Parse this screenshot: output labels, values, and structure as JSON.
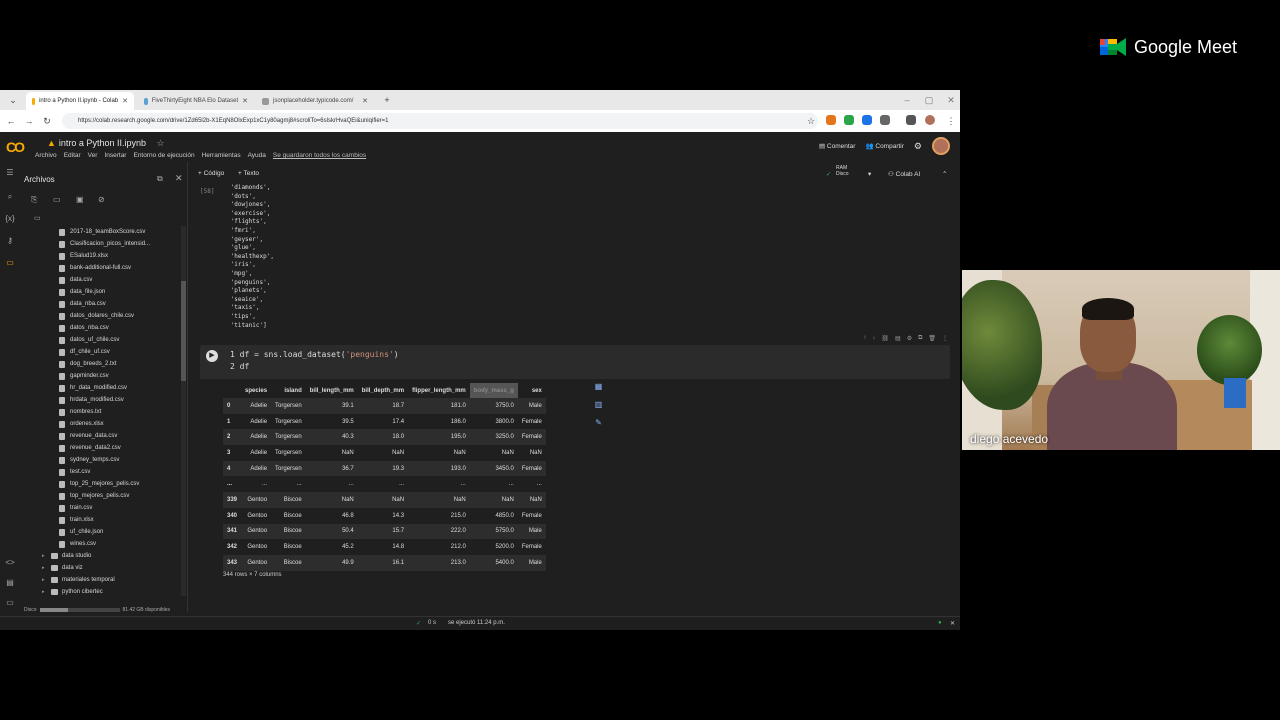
{
  "meet": {
    "brand": "Google Meet",
    "participant": "diego acevedo"
  },
  "browser": {
    "tabs": [
      {
        "title": "intro a Python II.ipynb - Colab",
        "active": true
      },
      {
        "title": "FiveThirtyEight NBA Elo Dataset",
        "active": false
      },
      {
        "title": "jsonplaceholder.typicode.com/",
        "active": false
      }
    ],
    "url": "https://colab.research.google.com/drive/1Zd65l2b-X1EqN8OlxExp1xC1y80agmj8#scrollTo=6slskrHvaQEi&uniqifier=1"
  },
  "colab": {
    "logo": "CO",
    "notebook_title": "intro a Python II.ipynb",
    "menu": [
      "Archivo",
      "Editar",
      "Ver",
      "Insertar",
      "Entorno de ejecución",
      "Herramientas",
      "Ayuda"
    ],
    "saved_status": "Se guardaron todos los cambios",
    "comment": "Comentar",
    "share": "Compartir",
    "add_code": "+ Código",
    "add_text": "+ Texto",
    "ram": "RAM",
    "disk_label": "Disco",
    "colab_ai": "Colab AI"
  },
  "files": {
    "title": "Archivos",
    "items": [
      {
        "name": "2017-18_teamBoxScore.csv",
        "type": "file"
      },
      {
        "name": "Clasificacion_picos_intensid...",
        "type": "file"
      },
      {
        "name": "ESalud19.xlsx",
        "type": "file"
      },
      {
        "name": "bank-additional-full.csv",
        "type": "file"
      },
      {
        "name": "data.csv",
        "type": "file"
      },
      {
        "name": "data_file.json",
        "type": "file"
      },
      {
        "name": "data_nba.csv",
        "type": "file"
      },
      {
        "name": "datos_dolares_chile.csv",
        "type": "file"
      },
      {
        "name": "datos_nba.csv",
        "type": "file"
      },
      {
        "name": "datos_uf_chile.csv",
        "type": "file"
      },
      {
        "name": "df_chile_uf.csv",
        "type": "file"
      },
      {
        "name": "dog_breeds_2.txt",
        "type": "file"
      },
      {
        "name": "gapminder.csv",
        "type": "file"
      },
      {
        "name": "hr_data_modified.csv",
        "type": "file"
      },
      {
        "name": "hrdata_modified.csv",
        "type": "file"
      },
      {
        "name": "nombres.txt",
        "type": "file"
      },
      {
        "name": "ordenes.xlsx",
        "type": "file"
      },
      {
        "name": "revenue_data.csv",
        "type": "file"
      },
      {
        "name": "revenue_data2.csv",
        "type": "file"
      },
      {
        "name": "sydney_temps.csv",
        "type": "file"
      },
      {
        "name": "test.csv",
        "type": "file"
      },
      {
        "name": "top_25_mejores_pelis.csv",
        "type": "file"
      },
      {
        "name": "top_mejores_pelis.csv",
        "type": "file"
      },
      {
        "name": "train.csv",
        "type": "file"
      },
      {
        "name": "train.xlsx",
        "type": "file"
      },
      {
        "name": "uf_chile.json",
        "type": "file"
      },
      {
        "name": "wines.csv",
        "type": "file"
      },
      {
        "name": "data studio",
        "type": "folder"
      },
      {
        "name": "data viz",
        "type": "folder"
      },
      {
        "name": "materiales temporal",
        "type": "folder"
      },
      {
        "name": "python cibertec",
        "type": "folder"
      }
    ],
    "disk_text": "Disco",
    "disk_available": "81.42 GB disponibles",
    "disk_fraction": 0.35
  },
  "notebook": {
    "output_label": "[58]",
    "output_list": [
      " 'diamonds',",
      " 'dots',",
      " 'dowjones',",
      " 'exercise',",
      " 'flights',",
      " 'fmri',",
      " 'geyser',",
      " 'glue',",
      " 'healthexp',",
      " 'iris',",
      " 'mpg',",
      " 'penguins',",
      " 'planets',",
      " 'seaice',",
      " 'taxis',",
      " 'tips',",
      " 'titanic']"
    ],
    "code_line1_pre": "1 df = sns.load_dataset(",
    "code_line1_str": "'penguins'",
    "code_line1_post": ")",
    "code_line2": "2 df",
    "df_columns": [
      "",
      "species",
      "island",
      "bill_length_mm",
      "bill_depth_mm",
      "flipper_length_mm",
      "body_mass_g",
      "sex"
    ],
    "df_rows": [
      [
        "0",
        "Adelie",
        "Torgersen",
        "39.1",
        "18.7",
        "181.0",
        "3750.0",
        "Male"
      ],
      [
        "1",
        "Adelie",
        "Torgersen",
        "39.5",
        "17.4",
        "186.0",
        "3800.0",
        "Female"
      ],
      [
        "2",
        "Adelie",
        "Torgersen",
        "40.3",
        "18.0",
        "195.0",
        "3250.0",
        "Female"
      ],
      [
        "3",
        "Adelie",
        "Torgersen",
        "NaN",
        "NaN",
        "NaN",
        "NaN",
        "NaN"
      ],
      [
        "4",
        "Adelie",
        "Torgersen",
        "36.7",
        "19.3",
        "193.0",
        "3450.0",
        "Female"
      ],
      [
        "...",
        "...",
        "...",
        "...",
        "...",
        "...",
        "...",
        "..."
      ],
      [
        "339",
        "Gentoo",
        "Biscoe",
        "NaN",
        "NaN",
        "NaN",
        "NaN",
        "NaN"
      ],
      [
        "340",
        "Gentoo",
        "Biscoe",
        "46.8",
        "14.3",
        "215.0",
        "4850.0",
        "Female"
      ],
      [
        "341",
        "Gentoo",
        "Biscoe",
        "50.4",
        "15.7",
        "222.0",
        "5750.0",
        "Male"
      ],
      [
        "342",
        "Gentoo",
        "Biscoe",
        "45.2",
        "14.8",
        "212.0",
        "5200.0",
        "Female"
      ],
      [
        "343",
        "Gentoo",
        "Biscoe",
        "49.9",
        "16.1",
        "213.0",
        "5400.0",
        "Male"
      ]
    ],
    "df_shape": "344 rows × 7 columns"
  },
  "status": {
    "seconds": "0 s",
    "executed": "se ejecutó 11:24 p.m."
  },
  "colors": {
    "accent": "#f9ab00",
    "meet_green": "#00ac47"
  }
}
